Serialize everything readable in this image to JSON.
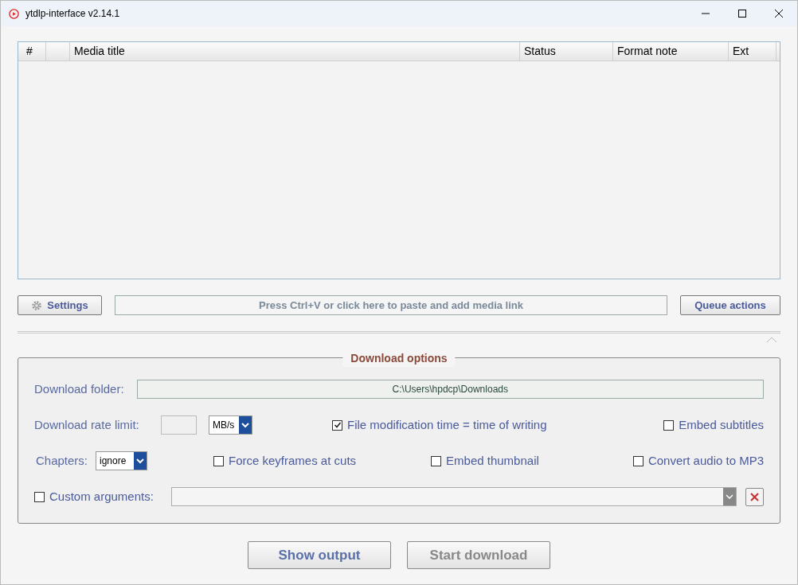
{
  "window": {
    "title": "ytdlp-interface v2.14.1"
  },
  "table": {
    "columns": [
      "#",
      "",
      "Media title",
      "Status",
      "Format note",
      "Ext"
    ]
  },
  "toolbar": {
    "settings": "Settings",
    "paste_hint": "Press Ctrl+V or click here to paste and add media link",
    "queue_actions": "Queue actions"
  },
  "download_options": {
    "title": "Download options",
    "folder_label": "Download folder:",
    "folder_value": "C:\\Users\\hpdcp\\Downloads",
    "rate_label": "Download rate limit:",
    "rate_unit": "MB/s",
    "chapters_label": "Chapters:",
    "chapters_value": "ignore",
    "options": [
      {
        "label": "File modification time = time of writing",
        "checked": true
      },
      {
        "label": "Embed subtitles",
        "checked": false
      },
      {
        "label": "Force keyframes at cuts",
        "checked": false
      },
      {
        "label": "Embed thumbnail",
        "checked": false
      },
      {
        "label": "Convert audio to MP3",
        "checked": false
      }
    ],
    "custom": {
      "label": "Custom arguments:",
      "checked": false
    }
  },
  "buttons": [
    {
      "label": "Show output",
      "disabled": false
    },
    {
      "label": "Start download",
      "disabled": true
    }
  ]
}
